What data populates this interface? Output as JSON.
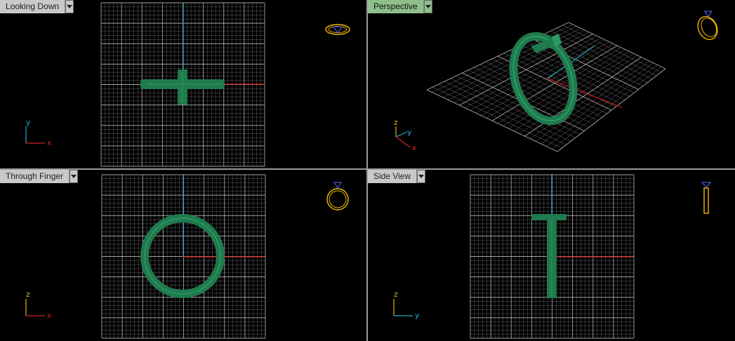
{
  "viewports": [
    {
      "id": "tl",
      "title": "Looking Down",
      "active": false,
      "axis_labels": {
        "h": "x",
        "v": "y"
      }
    },
    {
      "id": "tr",
      "title": "Perspective",
      "active": true,
      "axis_labels": {
        "z": "z",
        "y": "y",
        "x": "x"
      }
    },
    {
      "id": "bl",
      "title": "Through Finger",
      "active": false,
      "axis_labels": {
        "h": "x",
        "v": "z"
      }
    },
    {
      "id": "br",
      "title": "Side View",
      "active": false,
      "axis_labels": {
        "h": "y",
        "v": "z"
      }
    }
  ],
  "colors": {
    "grid": "#bdbdbd",
    "model": "#1f7a4e",
    "model_light": "#2e9a63",
    "axis_x": "#d32020",
    "axis_y": "#2aa8c8",
    "axis_z": "#e0b020",
    "nav_icon": "#f0b800",
    "tab_active": "#8fbf8c",
    "tab_inactive": "#c9c9c9"
  }
}
